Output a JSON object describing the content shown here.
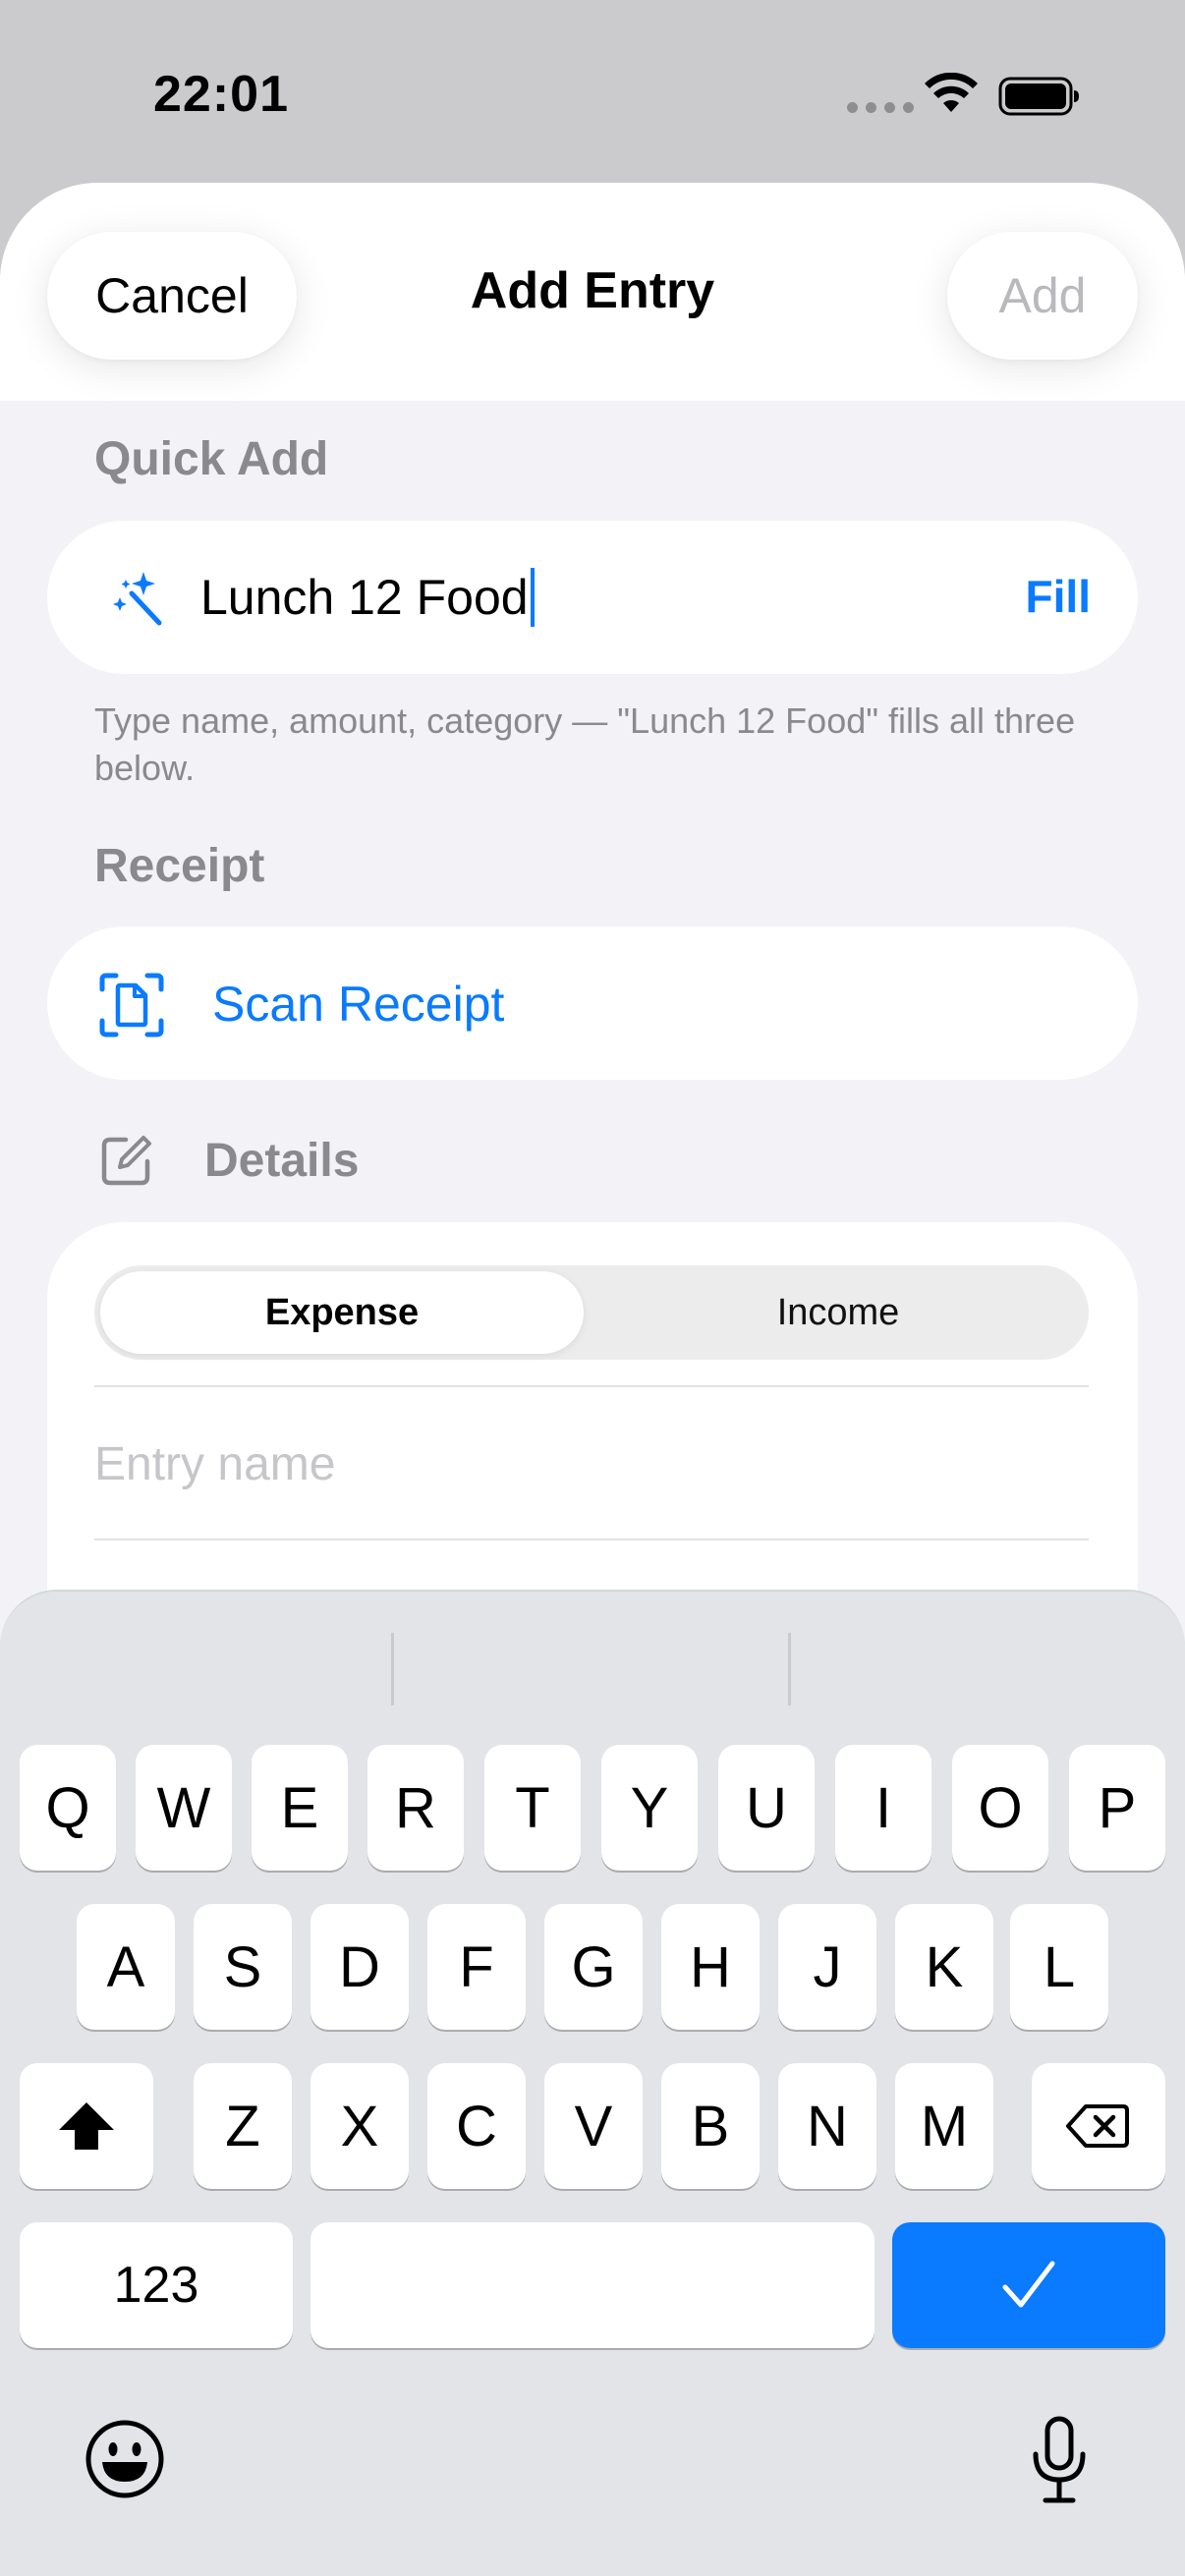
{
  "status_bar": {
    "time": "22:01"
  },
  "nav": {
    "cancel_label": "Cancel",
    "title": "Add Entry",
    "add_label": "Add"
  },
  "quick_add": {
    "header": "Quick Add",
    "value": "Lunch 12 Food",
    "fill_label": "Fill",
    "hint": "Type name, amount, category — \"Lunch 12 Food\" fills all three below."
  },
  "receipt": {
    "header": "Receipt",
    "scan_label": "Scan Receipt"
  },
  "details": {
    "header": "Details",
    "segments": [
      "Expense",
      "Income"
    ],
    "selected_segment": "Expense",
    "entry_name_placeholder": "Entry name"
  },
  "keyboard": {
    "row1": [
      "Q",
      "W",
      "E",
      "R",
      "T",
      "Y",
      "U",
      "I",
      "O",
      "P"
    ],
    "row2": [
      "A",
      "S",
      "D",
      "F",
      "G",
      "H",
      "J",
      "K",
      "L"
    ],
    "row3": [
      "Z",
      "X",
      "C",
      "V",
      "B",
      "N",
      "M"
    ],
    "numbers_label": "123",
    "accent": "#0a7aff"
  },
  "icons": {
    "quick_add": "magic-wand-icon",
    "receipt": "document-scanner-icon",
    "details": "square-pencil-icon",
    "shift": "shift-icon",
    "delete": "backspace-icon",
    "done": "checkmark-icon",
    "emoji": "smiley-icon",
    "dictation": "microphone-icon"
  }
}
